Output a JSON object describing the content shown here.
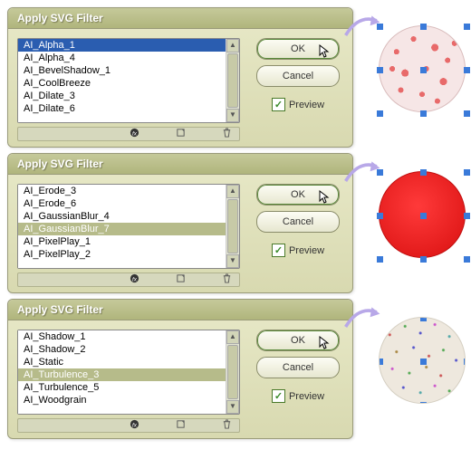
{
  "dialogs": [
    {
      "title": "Apply SVG Filter",
      "items": [
        "AI_Alpha_1",
        "AI_Alpha_4",
        "AI_BevelShadow_1",
        "AI_CoolBreeze",
        "AI_Dilate_3",
        "AI_Dilate_6"
      ],
      "selected_index": 0,
      "selected_style": "blue",
      "ok_label": "OK",
      "cancel_label": "Cancel",
      "preview_label": "Preview",
      "preview_checked": true,
      "preview_class": "preview-1"
    },
    {
      "title": "Apply SVG Filter",
      "items": [
        "AI_Erode_3",
        "AI_Erode_6",
        "AI_GaussianBlur_4",
        "AI_GaussianBlur_7",
        "AI_PixelPlay_1",
        "AI_PixelPlay_2"
      ],
      "selected_index": 3,
      "selected_style": "olive",
      "ok_label": "OK",
      "cancel_label": "Cancel",
      "preview_label": "Preview",
      "preview_checked": true,
      "preview_class": "preview-2"
    },
    {
      "title": "Apply SVG Filter",
      "items": [
        "AI_Shadow_1",
        "AI_Shadow_2",
        "AI_Static",
        "AI_Turbulence_3",
        "AI_Turbulence_5",
        "AI_Woodgrain"
      ],
      "selected_index": 3,
      "selected_style": "olive",
      "ok_label": "OK",
      "cancel_label": "Cancel",
      "preview_label": "Preview",
      "preview_checked": true,
      "preview_class": "preview-3"
    }
  ]
}
